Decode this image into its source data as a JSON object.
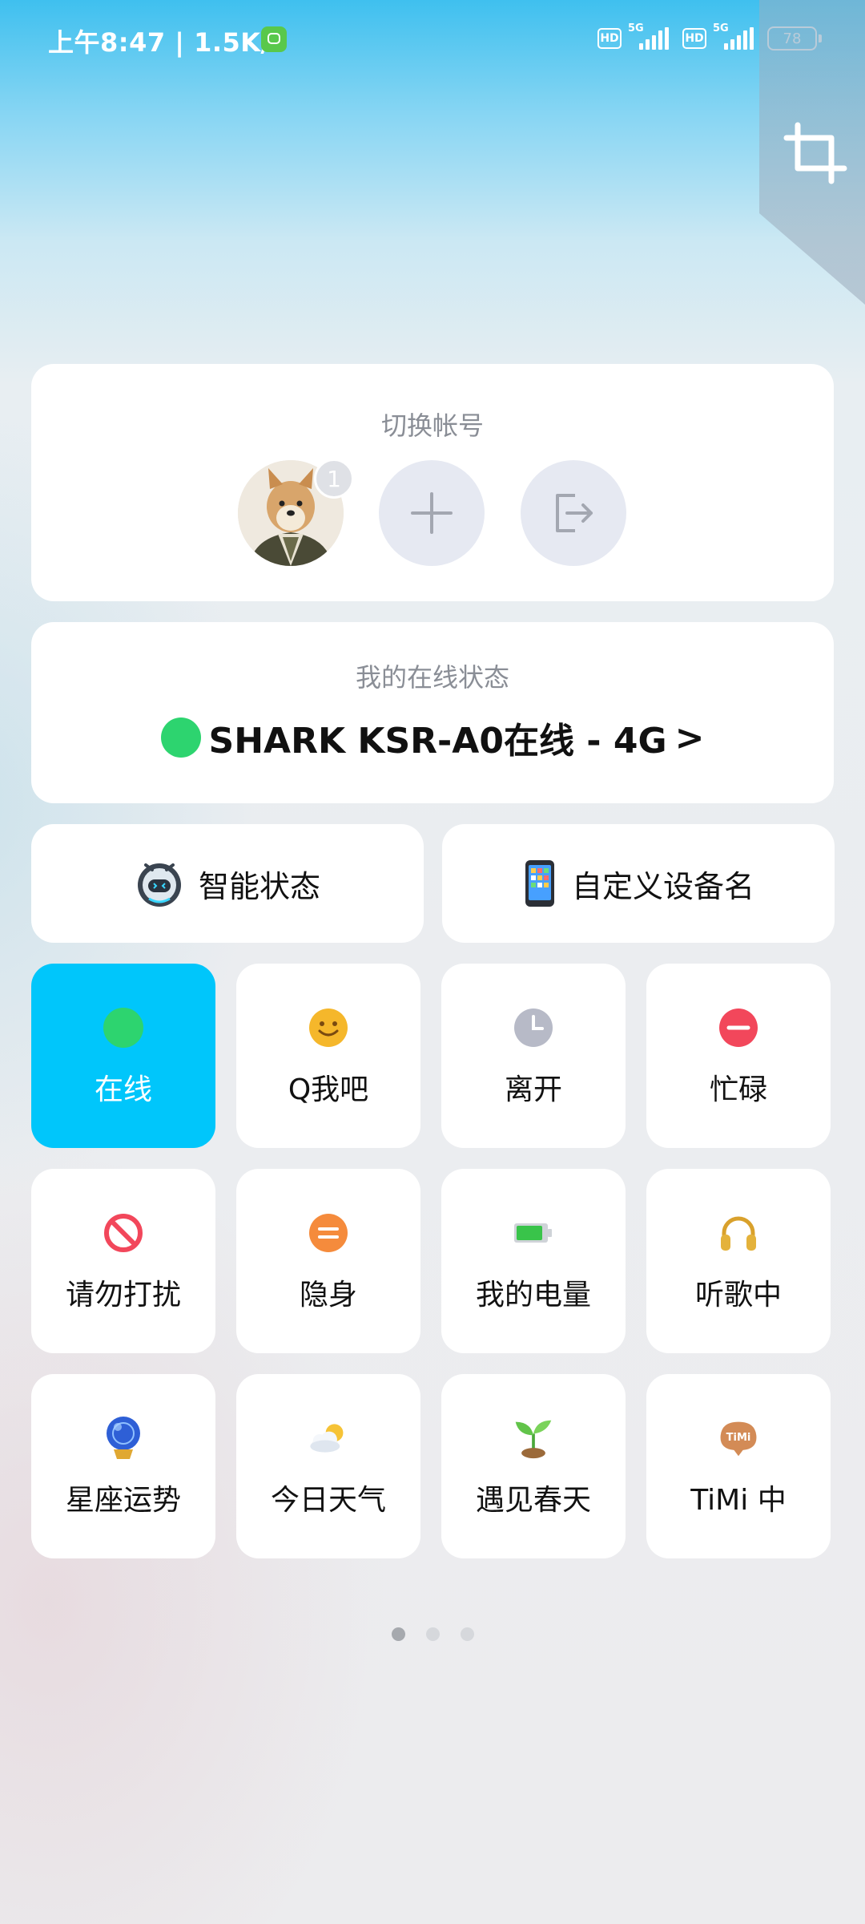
{
  "status_bar": {
    "time_speed": "上午8:47 | 1.5K/s",
    "hd_label": "HD",
    "net_label": "5G",
    "battery": "78"
  },
  "account": {
    "title": "切换帐号",
    "badge_count": "1"
  },
  "online_status": {
    "title": "我的在线状态",
    "text": "SHARK KSR-A0在线 - 4G",
    "chevron": ">"
  },
  "quick": {
    "smart": "智能状态",
    "custom": "自定义设备名"
  },
  "tiles": [
    {
      "label": "在线",
      "icon": "green-dot-icon",
      "active": true
    },
    {
      "label": "Q我吧",
      "icon": "smiley-icon"
    },
    {
      "label": "离开",
      "icon": "clock-icon"
    },
    {
      "label": "忙碌",
      "icon": "minus-circle-icon"
    },
    {
      "label": "请勿打扰",
      "icon": "no-entry-icon"
    },
    {
      "label": "隐身",
      "icon": "equals-circle-icon"
    },
    {
      "label": "我的电量",
      "icon": "battery-icon"
    },
    {
      "label": "听歌中",
      "icon": "headphones-icon"
    },
    {
      "label": "星座运势",
      "icon": "crystal-ball-icon"
    },
    {
      "label": "今日天气",
      "icon": "weather-icon"
    },
    {
      "label": "遇见春天",
      "icon": "sprout-icon"
    },
    {
      "label": "TiMi 中",
      "icon": "timi-icon"
    }
  ],
  "timi_logo_text": "TiMi",
  "pager": {
    "pages": 3,
    "current": 1
  },
  "colors": {
    "accent": "#00c6fb",
    "online_green": "#2dd46f",
    "busy_red": "#f2475b",
    "q_yellow": "#f5b72b"
  }
}
